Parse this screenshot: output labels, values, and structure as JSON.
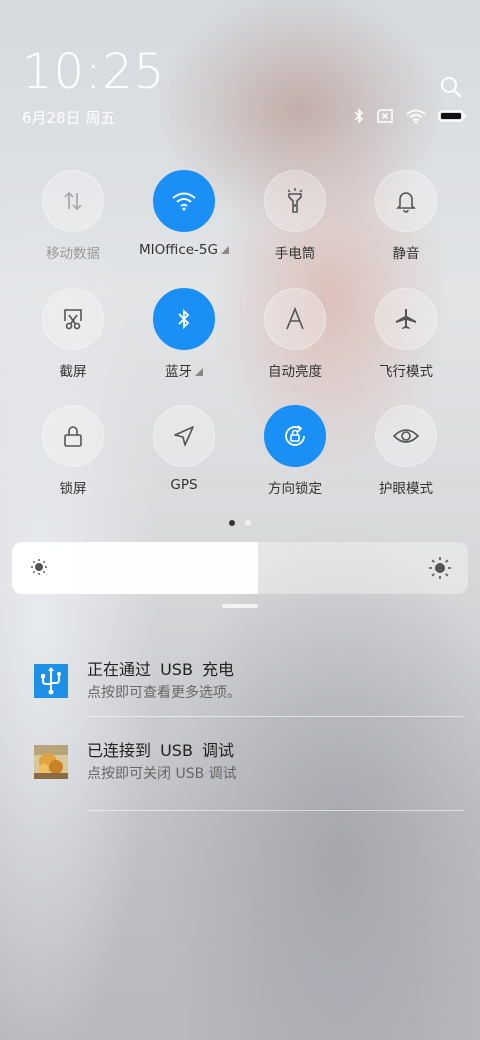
{
  "status": {
    "time": "10:25",
    "date": "6月28日 周五",
    "icons": [
      "bluetooth-icon",
      "no-sim-icon",
      "wifi-icon",
      "battery-icon"
    ]
  },
  "tiles": [
    {
      "label": "移动数据",
      "icon": "mobile-data-icon",
      "active": false
    },
    {
      "label": "MIOffice-5G",
      "icon": "wifi-icon",
      "active": true
    },
    {
      "label": "手电筒",
      "icon": "flashlight-icon",
      "active": false
    },
    {
      "label": "静音",
      "icon": "bell-icon",
      "active": false
    },
    {
      "label": "截屏",
      "icon": "screenshot-icon",
      "active": false
    },
    {
      "label": "蓝牙",
      "icon": "bluetooth-icon",
      "active": true
    },
    {
      "label": "自动亮度",
      "icon": "auto-brightness-icon",
      "active": false
    },
    {
      "label": "飞行模式",
      "icon": "airplane-icon",
      "active": false
    },
    {
      "label": "锁屏",
      "icon": "lock-icon",
      "active": false
    },
    {
      "label": "GPS",
      "icon": "gps-icon",
      "active": false
    },
    {
      "label": "方向锁定",
      "icon": "rotation-lock-icon",
      "active": true
    },
    {
      "label": "护眼模式",
      "icon": "eye-icon",
      "active": false
    }
  ],
  "pager": {
    "pages": 2,
    "current": 1
  },
  "brightness": {
    "level": 0.54
  },
  "notifications": [
    {
      "title": "正在通过 USB 充电",
      "desc": "点按即可查看更多选项。",
      "icon": "usb-icon"
    },
    {
      "title": "已连接到 USB 调试",
      "desc": "点按即可关闭 USB 调试",
      "icon": "debug-app-icon"
    }
  ],
  "colors": {
    "accent": "#1a8ff5"
  }
}
